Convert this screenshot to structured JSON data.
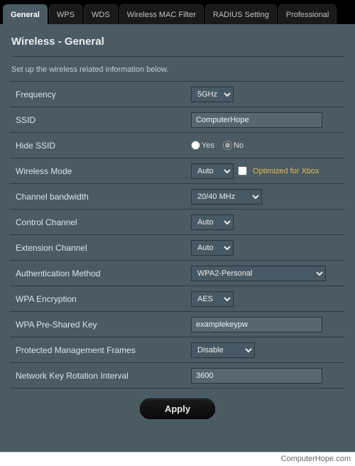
{
  "tabs": {
    "general": "General",
    "wps": "WPS",
    "wds": "WDS",
    "macfilter": "Wireless MAC Filter",
    "radius": "RADIUS Setting",
    "professional": "Professional"
  },
  "page_title": "Wireless - General",
  "instruction": "Set up the wireless related information below.",
  "labels": {
    "frequency": "Frequency",
    "ssid": "SSID",
    "hide_ssid": "Hide SSID",
    "wireless_mode": "Wireless Mode",
    "channel_bandwidth": "Channel bandwidth",
    "control_channel": "Control Channel",
    "extension_channel": "Extension Channel",
    "auth_method": "Authentication Method",
    "wpa_encryption": "WPA Encryption",
    "wpa_psk": "WPA Pre-Shared Key",
    "pmf": "Protected Management Frames",
    "key_rotation": "Network Key Rotation Interval"
  },
  "values": {
    "frequency": "5GHz",
    "ssid": "ComputerHope",
    "hide_ssid": "No",
    "yes": "Yes",
    "no": "No",
    "wireless_mode": "Auto",
    "xbox_opt": "Optimized for Xbox",
    "channel_bandwidth": "20/40 MHz",
    "control_channel": "Auto",
    "extension_channel": "Auto",
    "auth_method": "WPA2-Personal",
    "wpa_encryption": "AES",
    "wpa_psk": "examplekeypw",
    "pmf": "Disable",
    "key_rotation": "3600"
  },
  "buttons": {
    "apply": "Apply"
  },
  "footer": "ComputerHope.com"
}
